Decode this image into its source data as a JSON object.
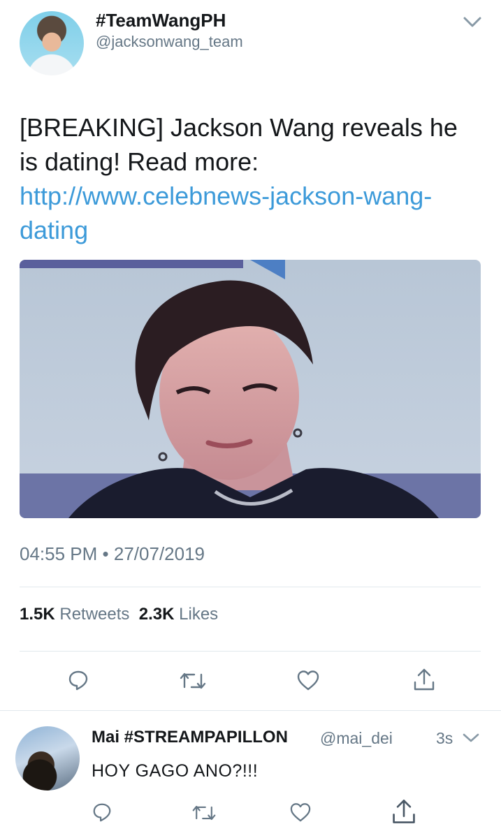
{
  "tweet": {
    "display_name": "#TeamWangPH",
    "handle": "@jacksonwang_team",
    "text_plain": "[BREAKING] Jackson Wang reveals he is dating! Read more: ",
    "link_text": "http://www.celebnews-jackson-wang-dating",
    "time": "04:55 PM",
    "separator": "•",
    "date": "27/07/2019",
    "retweets_count": "1.5K",
    "retweets_label": "Retweets",
    "likes_count": "2.3K",
    "likes_label": "Likes"
  },
  "reply": {
    "display_name": "Mai #STREAMPAPILLON",
    "handle": "@mai_dei",
    "age": "3s",
    "text": "HOY GAGO ANO?!!!"
  },
  "icons": [
    "chevron-down-icon",
    "reply-icon",
    "retweet-icon",
    "like-icon",
    "share-icon"
  ],
  "colors": {
    "link": "#3c9ad9",
    "secondary_text": "#657786",
    "icon": "#657786",
    "divider": "#e1e8ed"
  }
}
